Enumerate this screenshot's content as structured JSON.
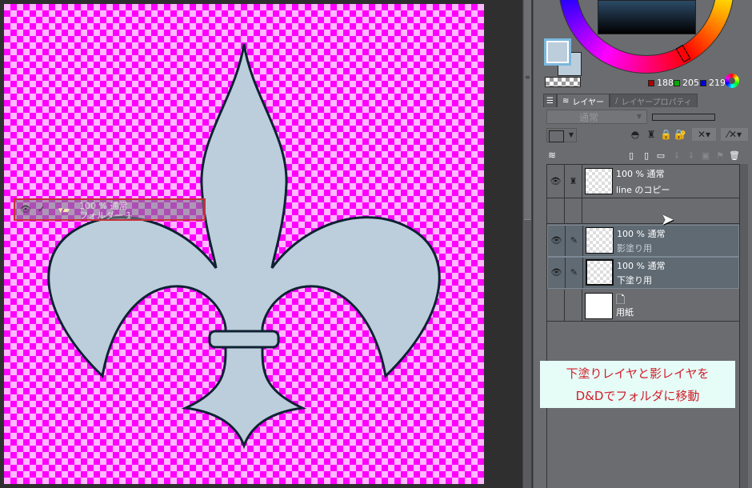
{
  "canvas": {
    "colors": {
      "checker_a": "#ff00ff",
      "checker_b": "#ffb8ff",
      "fill": "#bccddb",
      "outline": "#0e2233"
    }
  },
  "color_panel": {
    "r": "188",
    "g": "205",
    "b": "219",
    "main_color": "#bccddb"
  },
  "tabs": [
    {
      "label": "レイヤー",
      "icon": "layers-icon"
    },
    {
      "label": "レイヤープロパティ",
      "icon": "property-icon"
    }
  ],
  "blend_mode": "通常",
  "layers": [
    {
      "opacity": "100 %",
      "blend": "通常",
      "name": "line のコピー"
    },
    {
      "opacity": "100 %",
      "blend": "通常",
      "name": "影塗り用"
    },
    {
      "opacity": "100 %",
      "blend": "通常",
      "name": "下塗り用"
    },
    {
      "name": "用紙"
    }
  ],
  "dragged_folder": {
    "opacity": "100 %",
    "blend": "通常",
    "name": "フォルダー 1"
  },
  "annotation": {
    "line1": "下塗りレイヤと影レイヤを",
    "line2": "D&Dでフォルダに移動"
  }
}
